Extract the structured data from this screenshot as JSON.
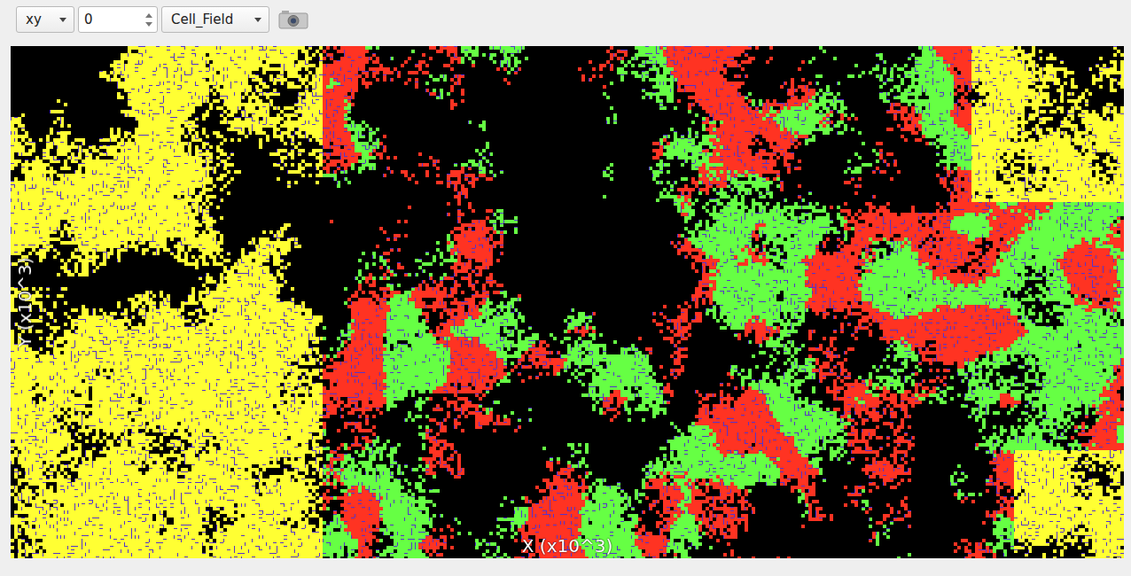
{
  "toolbar": {
    "plane": {
      "value": "xy"
    },
    "slice": {
      "value": "0"
    },
    "field": {
      "value": "Cell_Field"
    }
  },
  "view": {
    "x_axis": {
      "label": "X (x10^3)"
    },
    "y_axis": {
      "label": "Y (x10^3)"
    },
    "cell_types": [
      {
        "kind": "outer",
        "color": "#ffff33"
      },
      {
        "kind": "inner",
        "color": "#ff3322"
      },
      {
        "kind": "inner",
        "color": "#66ff44"
      }
    ],
    "border_color": "#5533cc"
  }
}
